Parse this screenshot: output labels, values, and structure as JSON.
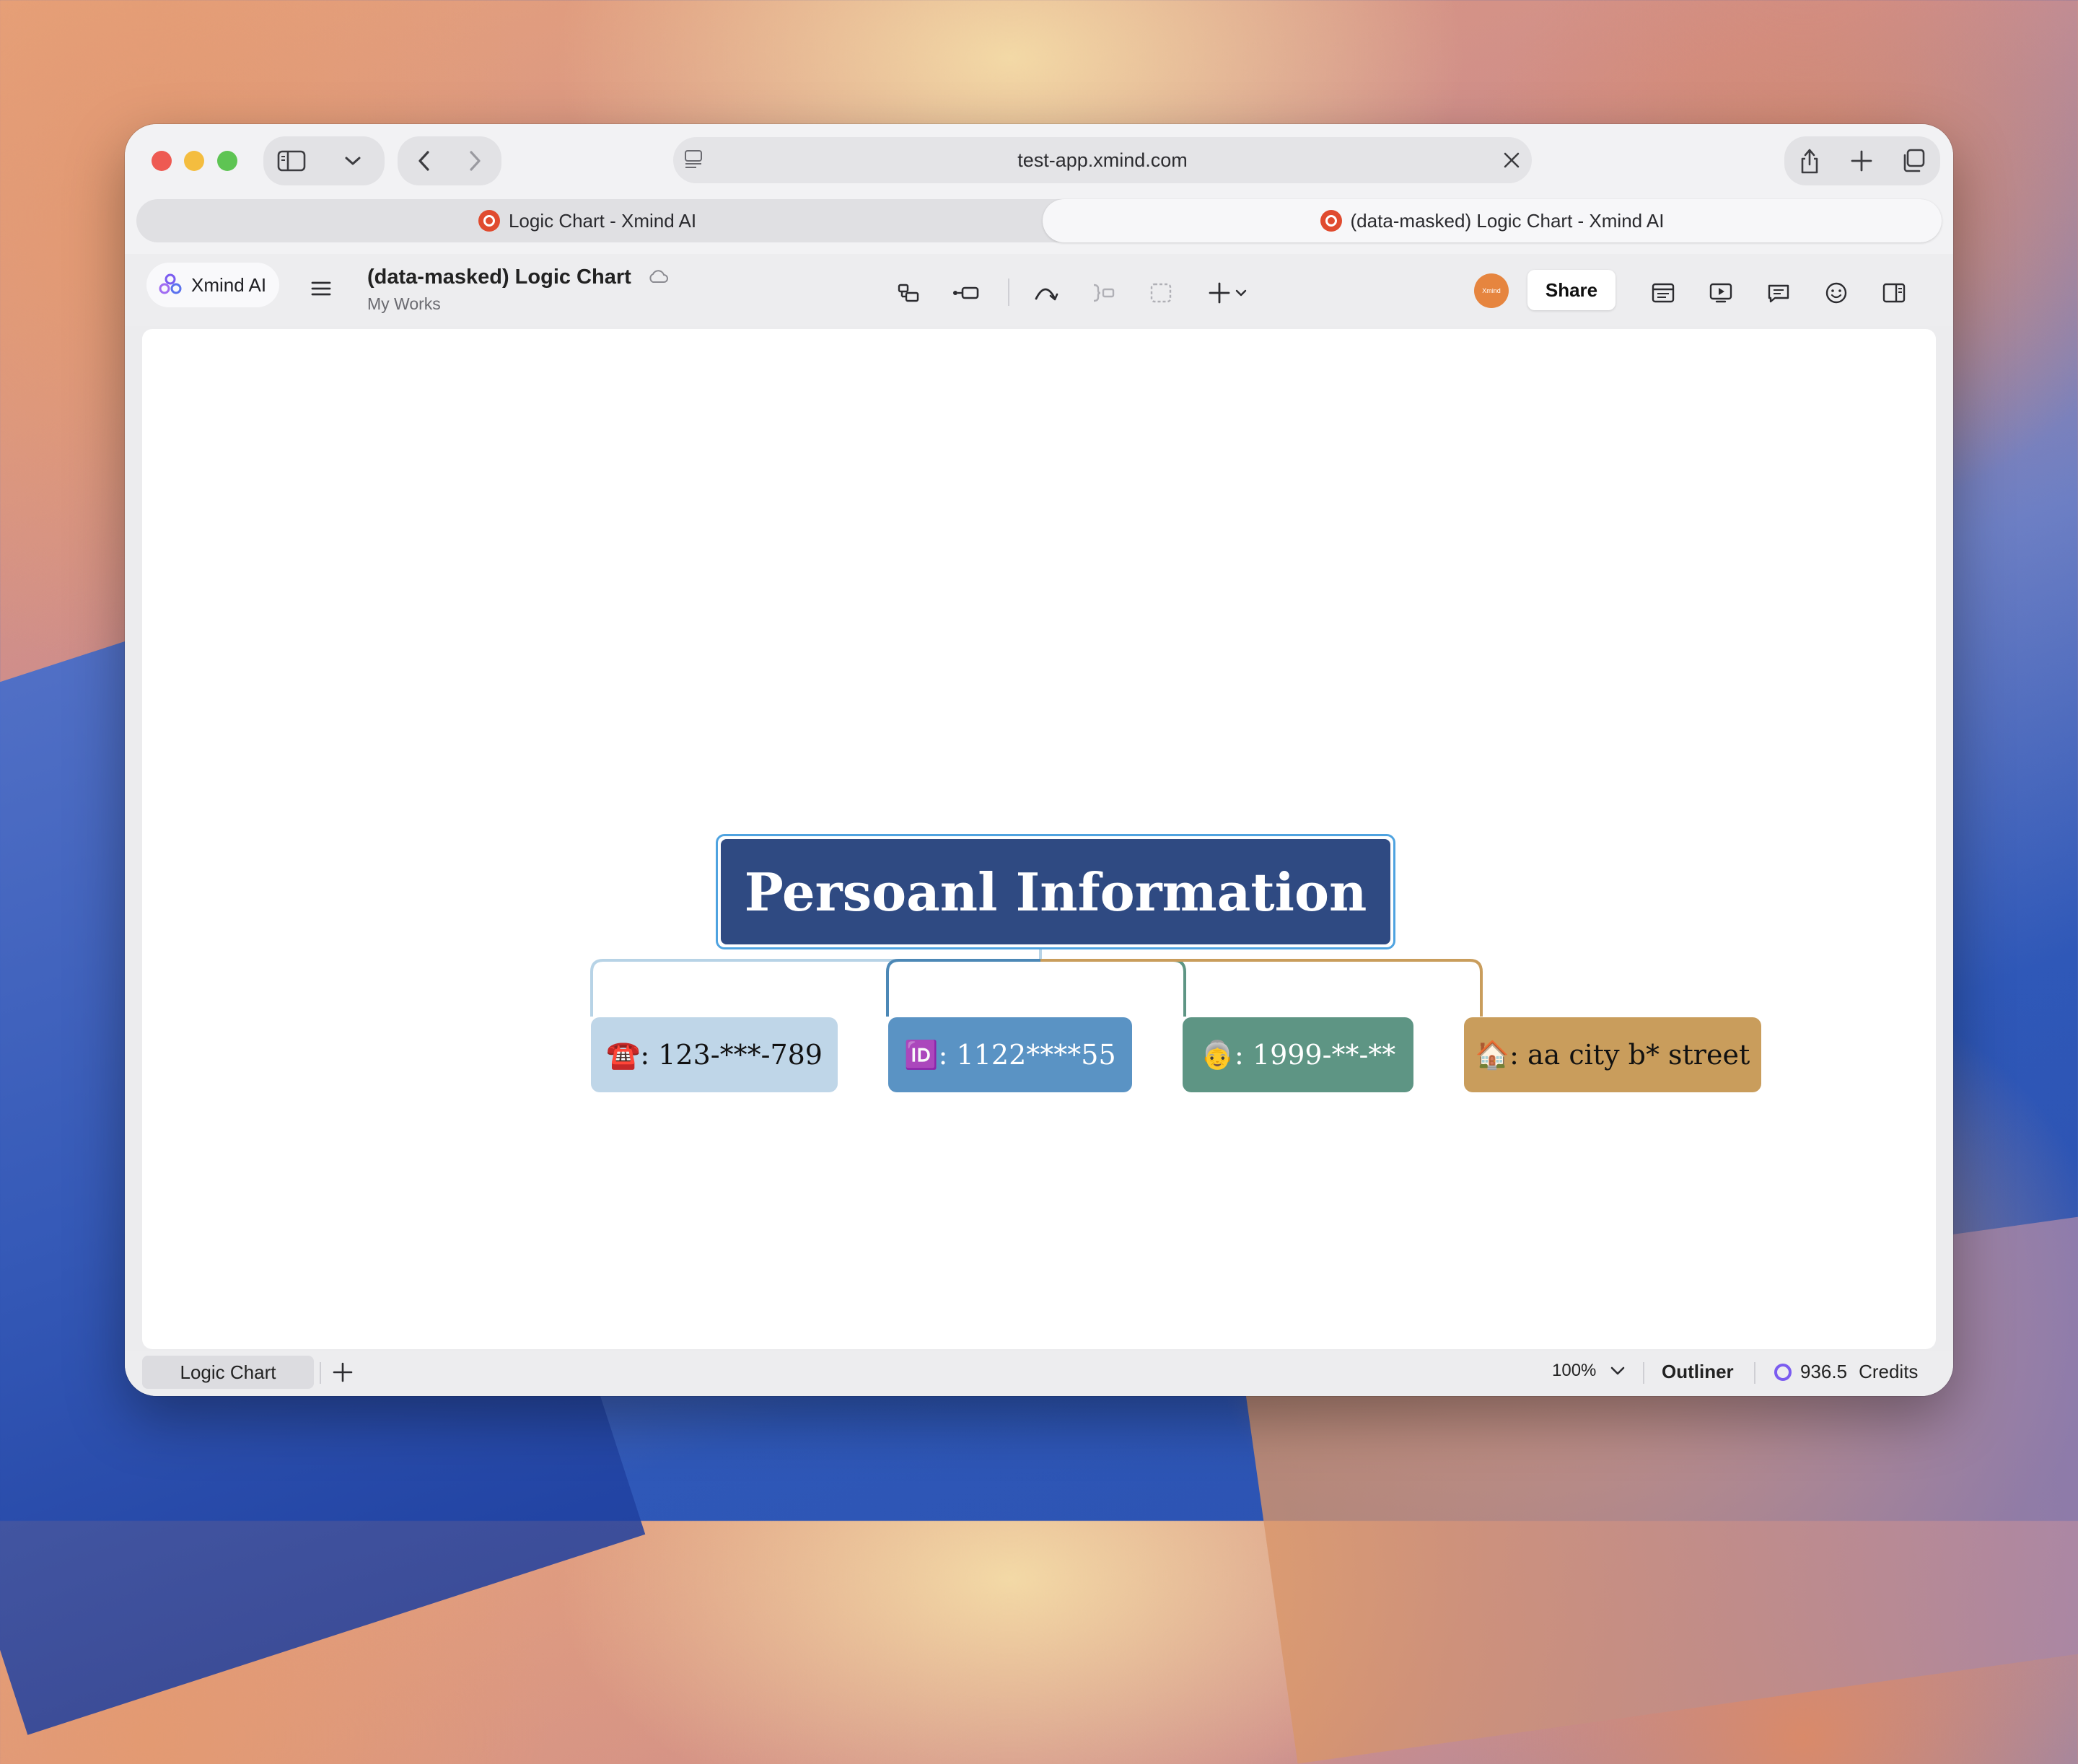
{
  "browser": {
    "url": "test-app.xmind.com",
    "tabs": [
      {
        "label": "Logic Chart - Xmind AI",
        "active": false
      },
      {
        "label": "(data-masked) Logic Chart - Xmind AI",
        "active": true
      }
    ]
  },
  "app": {
    "brand": "Xmind AI",
    "doc_title": "(data-masked) Logic Chart",
    "doc_location": "My Works",
    "avatar_text": "Xmind",
    "share_label": "Share"
  },
  "map": {
    "central": "Persoanl Information",
    "nodes": [
      {
        "label": "☎️: 123-***-789",
        "color": "#bfd6e8",
        "text_color": "#111111"
      },
      {
        "label": "🆔: 1122****55",
        "color": "#5a93c4",
        "text_color": "#ffffff"
      },
      {
        "label": "👵: 1999-**-**",
        "color": "#5e9584",
        "text_color": "#ffffff"
      },
      {
        "label": "🏠: aa city b* street",
        "color": "#c99d5c",
        "text_color": "#111111"
      }
    ],
    "branch_colors": [
      "#b7d3e6",
      "#4c88b6",
      "#5e9584",
      "#c99d5c"
    ],
    "central_color": "#2f4a82"
  },
  "status": {
    "sheet_tab": "Logic Chart",
    "zoom": "100%",
    "outliner": "Outliner",
    "credits_value": "936.5",
    "credits_label": "Credits"
  }
}
